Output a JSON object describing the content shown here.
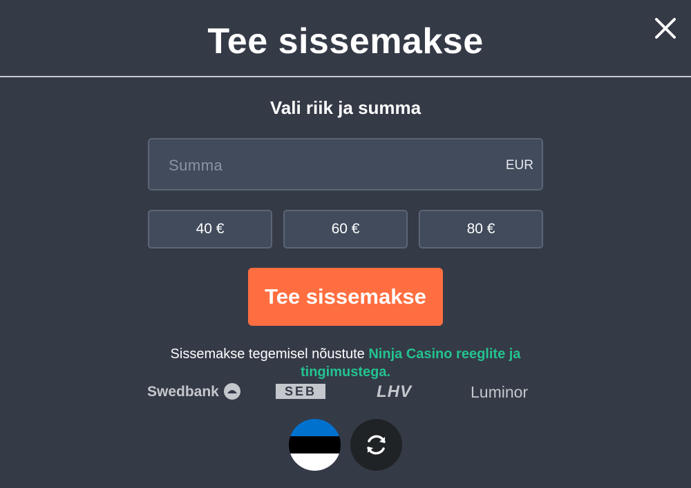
{
  "modal": {
    "title": "Tee sissemakse",
    "close_icon": "close-icon",
    "subtitle": "Vali riik ja summa"
  },
  "amount": {
    "placeholder": "Summa",
    "value": "",
    "currency": "EUR"
  },
  "presets": [
    "40 €",
    "60 €",
    "80 €"
  ],
  "submit_label": "Tee sissemakse",
  "terms": {
    "text": "Sissemakse tegemisel nõustute ",
    "link": "Ninja Casino reeglite ja tingimustega."
  },
  "banks": [
    "Swedbank",
    "SEB",
    "LHV",
    "Luminor"
  ],
  "country": {
    "flag_icon": "estonia-flag-icon",
    "flag_colors": [
      "#0072ce",
      "#000000",
      "#ffffff"
    ],
    "switch_icon": "refresh-icon"
  },
  "colors": {
    "background": "#353a47",
    "accent": "#ff6e40",
    "link": "#23c38f"
  }
}
